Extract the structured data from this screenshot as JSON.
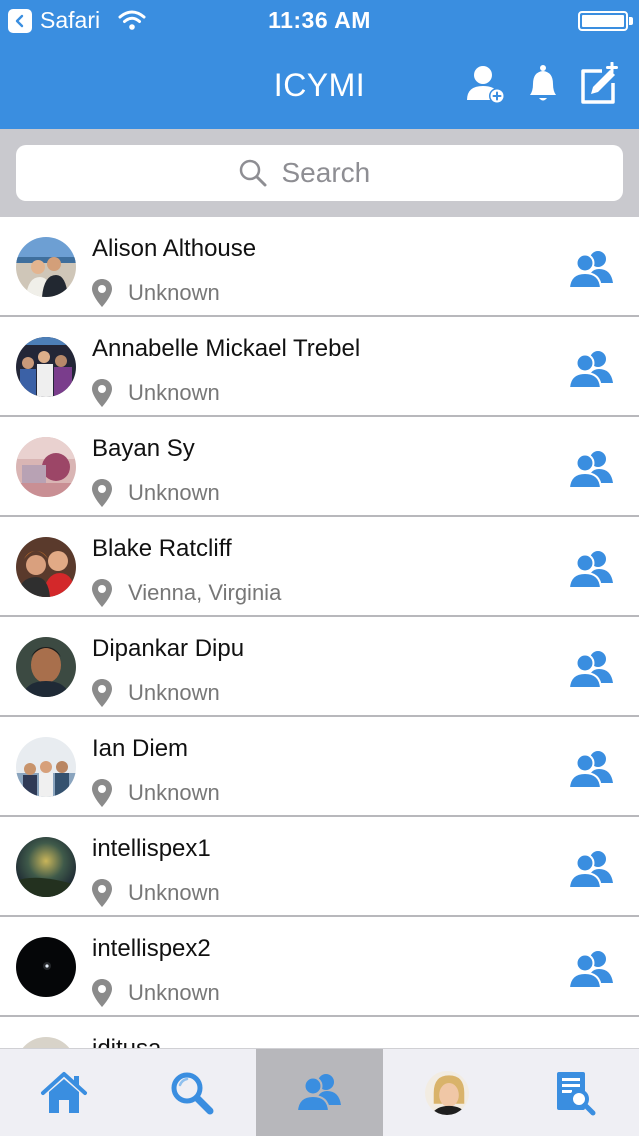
{
  "status_bar": {
    "back_app": "Safari",
    "time": "11:36 AM"
  },
  "nav": {
    "title": "ICYMI"
  },
  "search": {
    "placeholder": "Search"
  },
  "people": [
    {
      "name": "Alison Althouse",
      "location": "Unknown"
    },
    {
      "name": "Annabelle Mickael Trebel",
      "location": "Unknown"
    },
    {
      "name": "Bayan Sy",
      "location": "Unknown"
    },
    {
      "name": "Blake Ratcliff",
      "location": "Vienna, Virginia"
    },
    {
      "name": "Dipankar Dipu",
      "location": "Unknown"
    },
    {
      "name": "Ian Diem",
      "location": "Unknown"
    },
    {
      "name": "intellispex1",
      "location": "Unknown"
    },
    {
      "name": "intellispex2",
      "location": "Unknown"
    },
    {
      "name": "iditusa",
      "location": ""
    }
  ],
  "tabs": [
    {
      "icon": "home-icon",
      "active": false
    },
    {
      "icon": "search-icon",
      "active": false
    },
    {
      "icon": "people-icon",
      "active": true
    },
    {
      "icon": "profile-avatar",
      "active": false
    },
    {
      "icon": "document-search-icon",
      "active": false
    }
  ],
  "colors": {
    "accent": "#3a8ee0",
    "active_tab": "#b7b7bb",
    "separator": "#b8b8bc",
    "search_bg": "#c9c9ce"
  }
}
